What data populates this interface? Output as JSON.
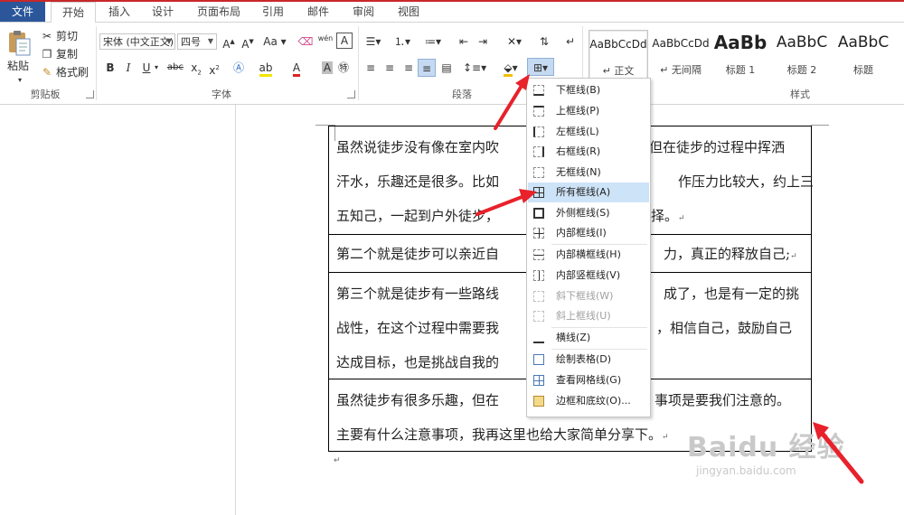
{
  "tabs": {
    "file": "文件",
    "home": "开始",
    "insert": "插入",
    "design": "设计",
    "layout": "页面布局",
    "references": "引用",
    "mailings": "邮件",
    "review": "审阅",
    "view": "视图"
  },
  "clipboard": {
    "paste": "粘贴",
    "cut": "剪切",
    "copy": "复制",
    "format_painter": "格式刷",
    "label": "剪贴板"
  },
  "font": {
    "name": "宋体 (中文正文)",
    "size": "四号",
    "label": "字体"
  },
  "paragraph": {
    "label": "段落"
  },
  "styles": {
    "label": "样式",
    "items": [
      {
        "preview": "AaBbCcDd",
        "name": "↵ 正文"
      },
      {
        "preview": "AaBbCcDd",
        "name": "↵ 无间隔"
      },
      {
        "preview": "AaBb",
        "name": "标题 1"
      },
      {
        "preview": "AaBbC",
        "name": "标题 2"
      },
      {
        "preview": "AaBbC",
        "name": "标题"
      }
    ]
  },
  "border_menu": {
    "items": [
      {
        "label": "下框线(B)",
        "disabled": false
      },
      {
        "label": "上框线(P)",
        "disabled": false
      },
      {
        "label": "左框线(L)",
        "disabled": false
      },
      {
        "label": "右框线(R)",
        "disabled": false
      },
      {
        "label": "无框线(N)",
        "disabled": false
      },
      {
        "label": "所有框线(A)",
        "disabled": false
      },
      {
        "label": "外侧框线(S)",
        "disabled": false
      },
      {
        "label": "内部框线(I)",
        "disabled": false
      },
      {
        "label": "内部横框线(H)",
        "disabled": false
      },
      {
        "label": "内部竖框线(V)",
        "disabled": false
      },
      {
        "label": "斜下框线(W)",
        "disabled": true
      },
      {
        "label": "斜上框线(U)",
        "disabled": true
      },
      {
        "label": "横线(Z)",
        "disabled": false
      },
      {
        "label": "绘制表格(D)",
        "disabled": false
      },
      {
        "label": "查看网格线(G)",
        "disabled": false
      },
      {
        "label": "边框和底纹(O)...",
        "disabled": false
      }
    ]
  },
  "document": {
    "rows": [
      [
        "虽然说徒步没有像在室内吹",
        "但在徒步的过程中挥洒",
        "汗水，乐趣还是很多。比如",
        "作压力比较大，约上三",
        "五知己，一起到户外徒步，",
        "择。"
      ],
      [
        "第二个就是徒步可以亲近自",
        "力，真正的释放自己;"
      ],
      [
        "第三个就是徒步有一些路线",
        "成了，也是有一定的挑",
        "战性，在这个过程中需要我",
        "，相信自己，鼓励自己",
        "达成目标，也是挑战自我的"
      ],
      [
        "虽然徒步有很多乐趣，但在",
        "事项是要我们注意的。",
        "主要有什么注意事项，我再这里也给大家简单分享下。"
      ]
    ]
  },
  "watermark": {
    "brand": "Baidu 经验",
    "url": "jingyan.baidu.com"
  }
}
